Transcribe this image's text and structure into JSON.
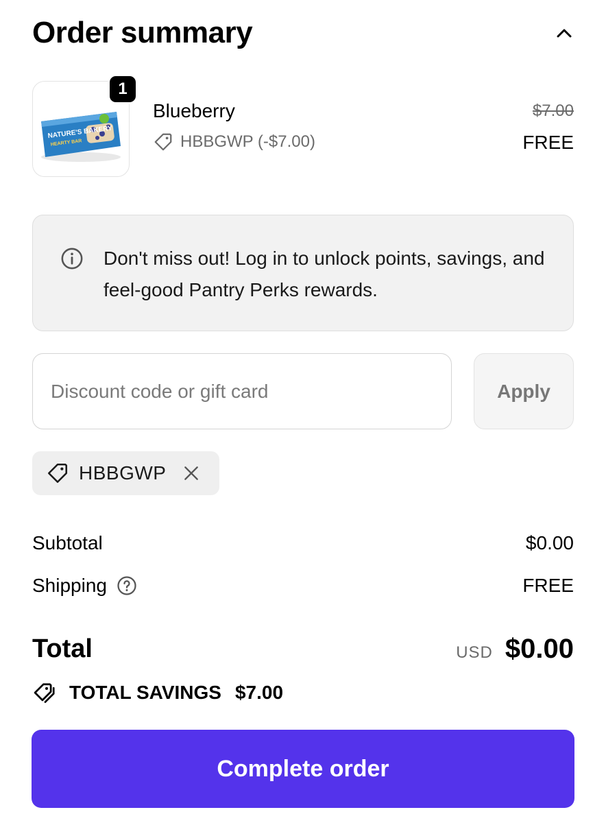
{
  "header": {
    "title": "Order summary"
  },
  "line_item": {
    "quantity": "1",
    "name": "Blueberry",
    "discount_label": "HBBGWP (-$7.00)",
    "original_price": "$7.00",
    "final_price": "FREE",
    "product_brand_text": "NATURE'S BAKERY",
    "product_subtitle_text": "HEARTY BAR"
  },
  "notice": {
    "text": "Don't miss out! Log in to unlock points, savings, and feel-good Pantry Perks rewards."
  },
  "discount": {
    "placeholder": "Discount code or gift card",
    "value": "",
    "apply_label": "Apply"
  },
  "applied_code": {
    "code": "HBBGWP"
  },
  "summary": {
    "subtotal_label": "Subtotal",
    "subtotal_value": "$0.00",
    "shipping_label": "Shipping",
    "shipping_value": "FREE",
    "total_label": "Total",
    "currency": "USD",
    "total_value": "$0.00",
    "savings_label": "TOTAL SAVINGS",
    "savings_value": "$7.00"
  },
  "cta": {
    "label": "Complete order"
  },
  "colors": {
    "primary_button": "#5433eb",
    "product_wrapper": "#2a7fc4"
  }
}
